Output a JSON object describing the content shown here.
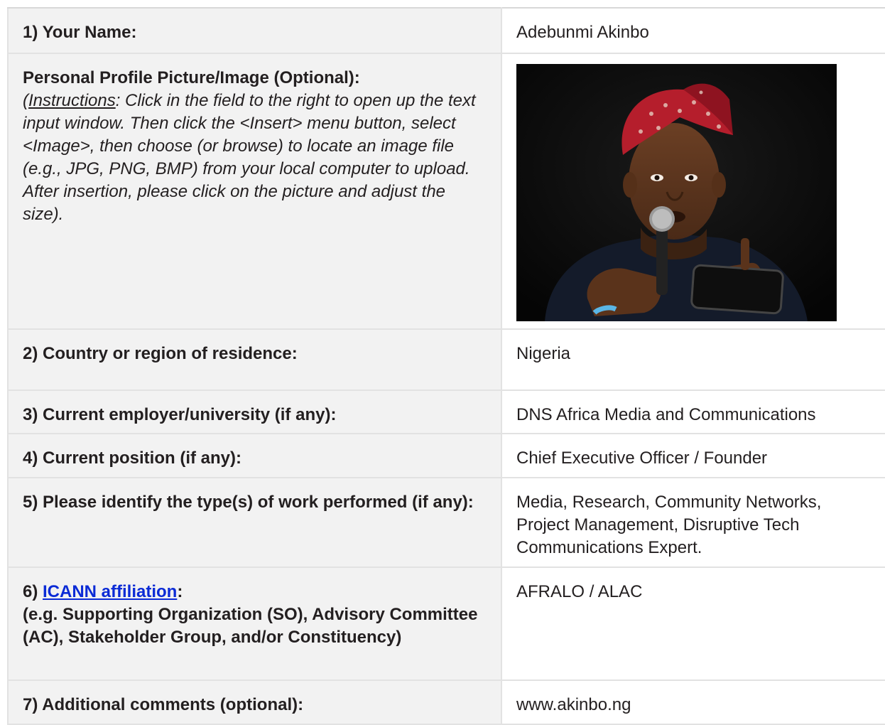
{
  "form": {
    "rows": [
      {
        "label": "1) Your Name:",
        "value": "Adebunmi Akinbo"
      },
      {
        "label": "Personal Profile Picture/Image (Optional):",
        "instructions_prefix": "(",
        "instructions_word": "Instructions",
        "instructions_rest": ": Click in the field to the right to open up the text input window. Then click the <Insert> menu button, select <Image>, then choose (or browse) to locate an image file (e.g., JPG, PNG, BMP) from your local computer to upload. After insertion, please click on the picture and adjust the size)."
      },
      {
        "label": "2) Country or region of residence:",
        "value": "Nigeria"
      },
      {
        "label": "3) Current employer/university (if any):",
        "value": "DNS Africa Media and Communications"
      },
      {
        "label": "4) Current position (if any):",
        "value": "Chief Executive Officer / Founder"
      },
      {
        "label": "5) Please identify the type(s) of work performed (if any):",
        "value": "Media, Research, Community Networks, Project Management, Disruptive Tech Communications Expert."
      },
      {
        "label_prefix": "6) ",
        "label_link": "ICANN affiliation",
        "label_suffix": ":",
        "label_detail": "(e.g. Supporting Organization (SO), Advisory Committee (AC), Stakeholder Group, and/or Constituency)",
        "value": "AFRALO / ALAC"
      },
      {
        "label": "7) Additional comments (optional):",
        "value": "www.akinbo.ng"
      }
    ]
  },
  "colors": {
    "label_background": "#f2f2f2",
    "border": "#e2e2e2",
    "link": "#0b2bd6"
  }
}
